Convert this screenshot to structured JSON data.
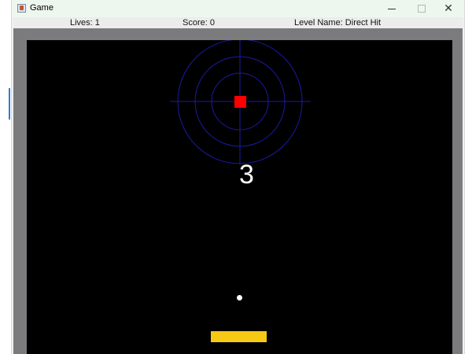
{
  "window": {
    "title": "Game",
    "icon": "java-app-icon",
    "controls": [
      "minimize-icon",
      "maximize-icon",
      "close-icon"
    ]
  },
  "status": {
    "lives": "Lives: 1",
    "score": "Score: 0",
    "level": "Level Name: Direct Hit"
  },
  "game": {
    "countdown": "3",
    "colors": {
      "background": "#000000",
      "frame": "#7b7b7d",
      "crosshair": "#1a1aa8",
      "target_block": "#ff0000",
      "ball": "#ffffff",
      "paddle": "#f6c915"
    }
  }
}
